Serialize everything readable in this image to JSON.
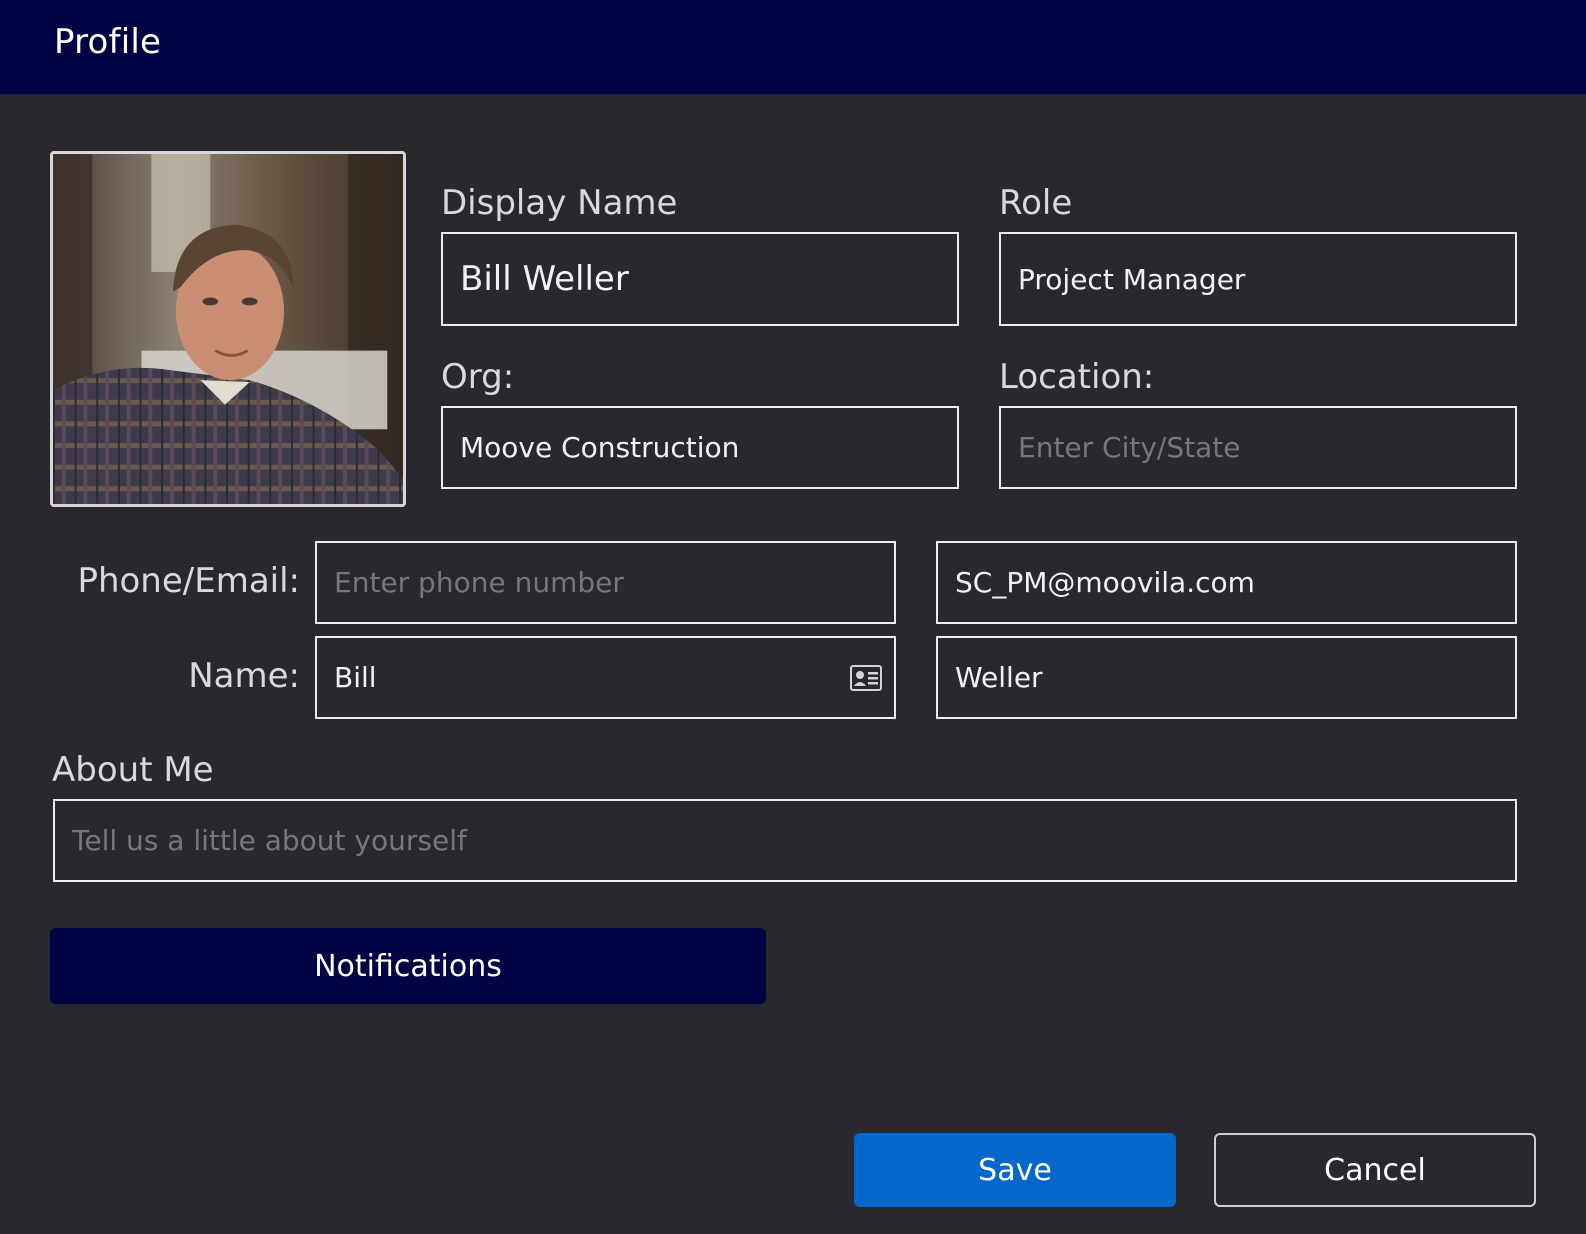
{
  "header": {
    "title": "Profile"
  },
  "avatar": {
    "alt": "profile-photo"
  },
  "fields": {
    "display_name": {
      "label": "Display Name",
      "value": "Bill Weller"
    },
    "role": {
      "label": "Role",
      "value": "Project Manager"
    },
    "org": {
      "label": "Org:",
      "value": "Moove Construction"
    },
    "location": {
      "label": "Location:",
      "value": "",
      "placeholder": "Enter City/State"
    },
    "phone_email_label": "Phone/Email:",
    "phone": {
      "value": "",
      "placeholder": "Enter phone number"
    },
    "email": {
      "value": "SC_PM@moovila.com"
    },
    "name_label": "Name:",
    "first_name": {
      "value": "Bill",
      "icon": "contact-card-icon"
    },
    "last_name": {
      "value": "Weller"
    },
    "about_me": {
      "label": "About Me",
      "value": "",
      "placeholder": "Tell us a little about yourself"
    }
  },
  "buttons": {
    "notifications": "Notifications",
    "save": "Save",
    "cancel": "Cancel"
  },
  "colors": {
    "header_bg": "#010342",
    "body_bg": "#29282e",
    "save_bg": "#0567c9",
    "notifications_bg": "#010342"
  }
}
